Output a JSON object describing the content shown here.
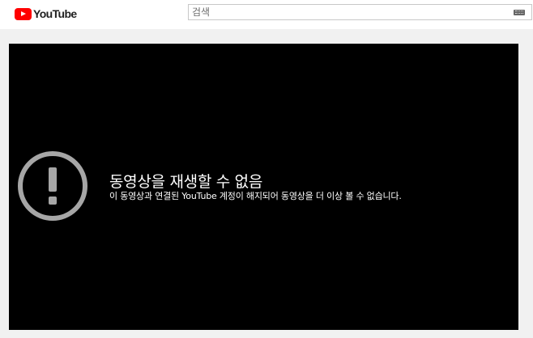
{
  "header": {
    "logo_text": "YouTube",
    "search": {
      "placeholder": "검색",
      "value": ""
    },
    "keyboard_icon": "keyboard-icon"
  },
  "player": {
    "error_icon": "exclamation-circle-icon",
    "error_title": "동영상을 재생할 수 없음",
    "error_message": "이 동영상과 연결된 YouTube 계정이 해지되어 동영상을 더 이상 볼 수 없습니다."
  },
  "colors": {
    "brand_red": "#ff0000",
    "player_bg": "#000000",
    "page_bg": "#f1f1f1",
    "icon_gray": "#a6a6a6"
  }
}
